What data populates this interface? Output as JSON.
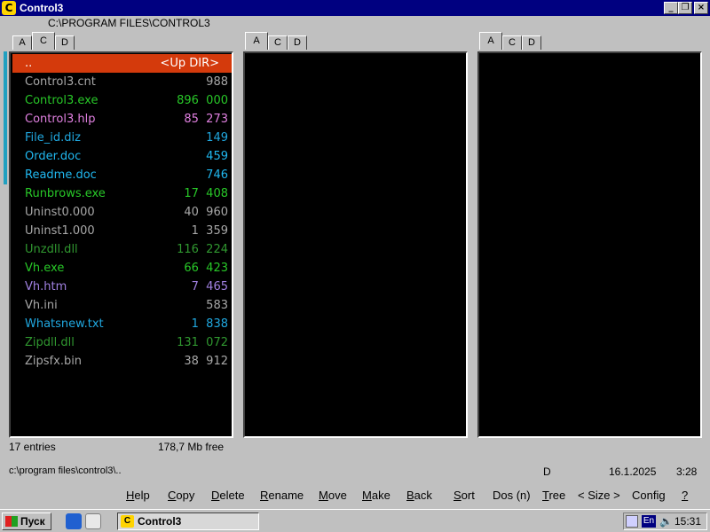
{
  "window": {
    "title": "Control3",
    "path": "C:\\PROGRAM FILES\\CONTROL3"
  },
  "tabs": {
    "left": [
      "A",
      "C",
      "D"
    ],
    "mid": [
      "A",
      "C",
      "D"
    ],
    "right": [
      "A",
      "C",
      "D"
    ],
    "left_active": "C",
    "mid_active": "A",
    "right_active": "A"
  },
  "files": [
    {
      "name": "..",
      "size": "<Up DIR>",
      "color": "#ffffff",
      "selected": true
    },
    {
      "name": "Control3.cnt",
      "size": "988",
      "color": "#a8a8a8"
    },
    {
      "name": "Control3.exe",
      "size": "896  000",
      "color": "#28c828"
    },
    {
      "name": "Control3.hlp",
      "size": "85  273",
      "color": "#e080e0"
    },
    {
      "name": "File_id.diz",
      "size": "149",
      "color": "#20a8e0"
    },
    {
      "name": "Order.doc",
      "size": "459",
      "color": "#20b8f0"
    },
    {
      "name": "Readme.doc",
      "size": "746",
      "color": "#20b8f0"
    },
    {
      "name": "Runbrows.exe",
      "size": "17  408",
      "color": "#28c828"
    },
    {
      "name": "Uninst0.000",
      "size": "40  960",
      "color": "#a8a8a8"
    },
    {
      "name": "Uninst1.000",
      "size": "1  359",
      "color": "#a8a8a8"
    },
    {
      "name": "Unzdll.dll",
      "size": "116  224",
      "color": "#309830"
    },
    {
      "name": "Vh.exe",
      "size": "66  423",
      "color": "#28c828"
    },
    {
      "name": "Vh.htm",
      "size": "7  465",
      "color": "#a080e0"
    },
    {
      "name": "Vh.ini",
      "size": "583",
      "color": "#a8a8a8"
    },
    {
      "name": "Whatsnew.txt",
      "size": "1  838",
      "color": "#20a8e0"
    },
    {
      "name": "Zipdll.dll",
      "size": "131  072",
      "color": "#309830"
    },
    {
      "name": "Zipsfx.bin",
      "size": "38  912",
      "color": "#a8a8a8"
    }
  ],
  "status": {
    "entries": "17 entries",
    "free": "178,7 Mb free",
    "cmdline": "c:\\program files\\control3\\..",
    "drive": "D",
    "date": "16.1.2025",
    "clock": "3:28"
  },
  "function_keys": [
    {
      "label": "Help",
      "u": "H",
      "rest": "elp"
    },
    {
      "label": "Copy",
      "u": "C",
      "rest": "opy"
    },
    {
      "label": "Delete",
      "u": "D",
      "rest": "elete"
    },
    {
      "label": "Rename",
      "u": "R",
      "rest": "ename"
    },
    {
      "label": "Move",
      "u": "M",
      "rest": "ove"
    },
    {
      "label": "Make",
      "u": "M",
      "rest": "ake"
    },
    {
      "label": "Back",
      "u": "B",
      "rest": "ack"
    },
    {
      "label": "Sort",
      "u": "S",
      "rest": "ort"
    },
    {
      "label": "Dos (n)"
    },
    {
      "label": "Tree",
      "u": "T",
      "rest": "ree"
    },
    {
      "label": "< Size >"
    },
    {
      "label": "Config"
    },
    {
      "label": "?",
      "u": "?",
      "rest": ""
    }
  ],
  "taskbar": {
    "start_label": "Пуск",
    "task_label": "Control3",
    "lang": "En",
    "time": "15:31"
  },
  "icons": {
    "app": "control3-icon",
    "minimize": "minimize-icon",
    "restore": "restore-icon",
    "close": "close-icon"
  }
}
